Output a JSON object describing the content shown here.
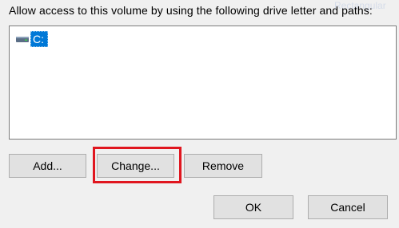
{
  "watermark": {
    "text": "Rectangular"
  },
  "instruction": "Allow access to this volume by using the following drive letter and paths:",
  "path_list": {
    "items": [
      {
        "label": "C:",
        "icon": "drive-icon",
        "selected": true
      }
    ]
  },
  "buttons": {
    "add": "Add...",
    "change": "Change...",
    "remove": "Remove",
    "ok": "OK",
    "cancel": "Cancel"
  },
  "colors": {
    "selection": "#0078d7",
    "highlight_box": "#e0161f",
    "dialog_background": "#f0f0f0"
  }
}
